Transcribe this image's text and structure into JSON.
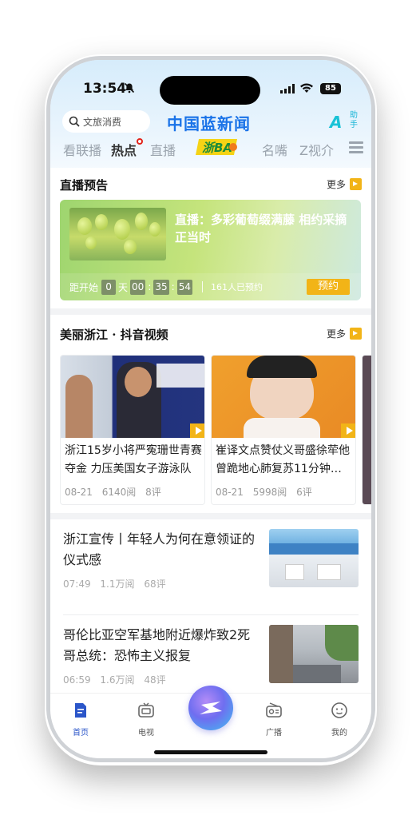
{
  "status_bar": {
    "time": "13:54",
    "battery": "85"
  },
  "header": {
    "search_placeholder": "文旅消费",
    "app_title": "中国蓝新闻",
    "assistant_label": "助手",
    "tabs": [
      {
        "label": "看联播"
      },
      {
        "label": "热点"
      },
      {
        "label": "直播"
      },
      {
        "label": "名嘴"
      },
      {
        "label": "Z视介"
      }
    ],
    "logo_text": "浙BA"
  },
  "live_preview": {
    "section_title": "直播预告",
    "more_label": "更多",
    "card_title": "直播：多彩葡萄缀满藤 相约采摘正当时",
    "countdown_label": "距开始",
    "days": "0",
    "days_unit": "天",
    "hours": "00",
    "minutes": "35",
    "seconds": "54",
    "reserved_count": "161人已预约",
    "reserve_button": "预约"
  },
  "video_section": {
    "section_title": "美丽浙江 · 抖音视频",
    "more_label": "更多",
    "cards": [
      {
        "title": "浙江15岁小将严寃珊世青赛夺金 力压美国女子游泳队",
        "date": "08-21",
        "views": "6140阅",
        "comments": "8评"
      },
      {
        "title": "崔译文点赞仗义哥盛徐荦他曾跪地心肺复苏11分钟…",
        "date": "08-21",
        "views": "5998阅",
        "comments": "6评"
      }
    ]
  },
  "news": [
    {
      "title": "浙江宣传丨年轻人为何在意领证的仪式感",
      "time": "07:49",
      "views": "1.1万阅",
      "comments": "68评"
    },
    {
      "title": "哥伦比亚空军基地附近爆炸致2死 哥总统：恐怖主义报复",
      "time": "06:59",
      "views": "1.6万阅",
      "comments": "48评"
    }
  ],
  "tab_bar": {
    "items": [
      {
        "label": "首页"
      },
      {
        "label": "电视"
      },
      {
        "label": "广播"
      },
      {
        "label": "我的"
      }
    ]
  },
  "colors": {
    "brand_blue": "#1a73e8",
    "accent_yellow": "#f2b417",
    "hot_red": "#e2231a"
  }
}
